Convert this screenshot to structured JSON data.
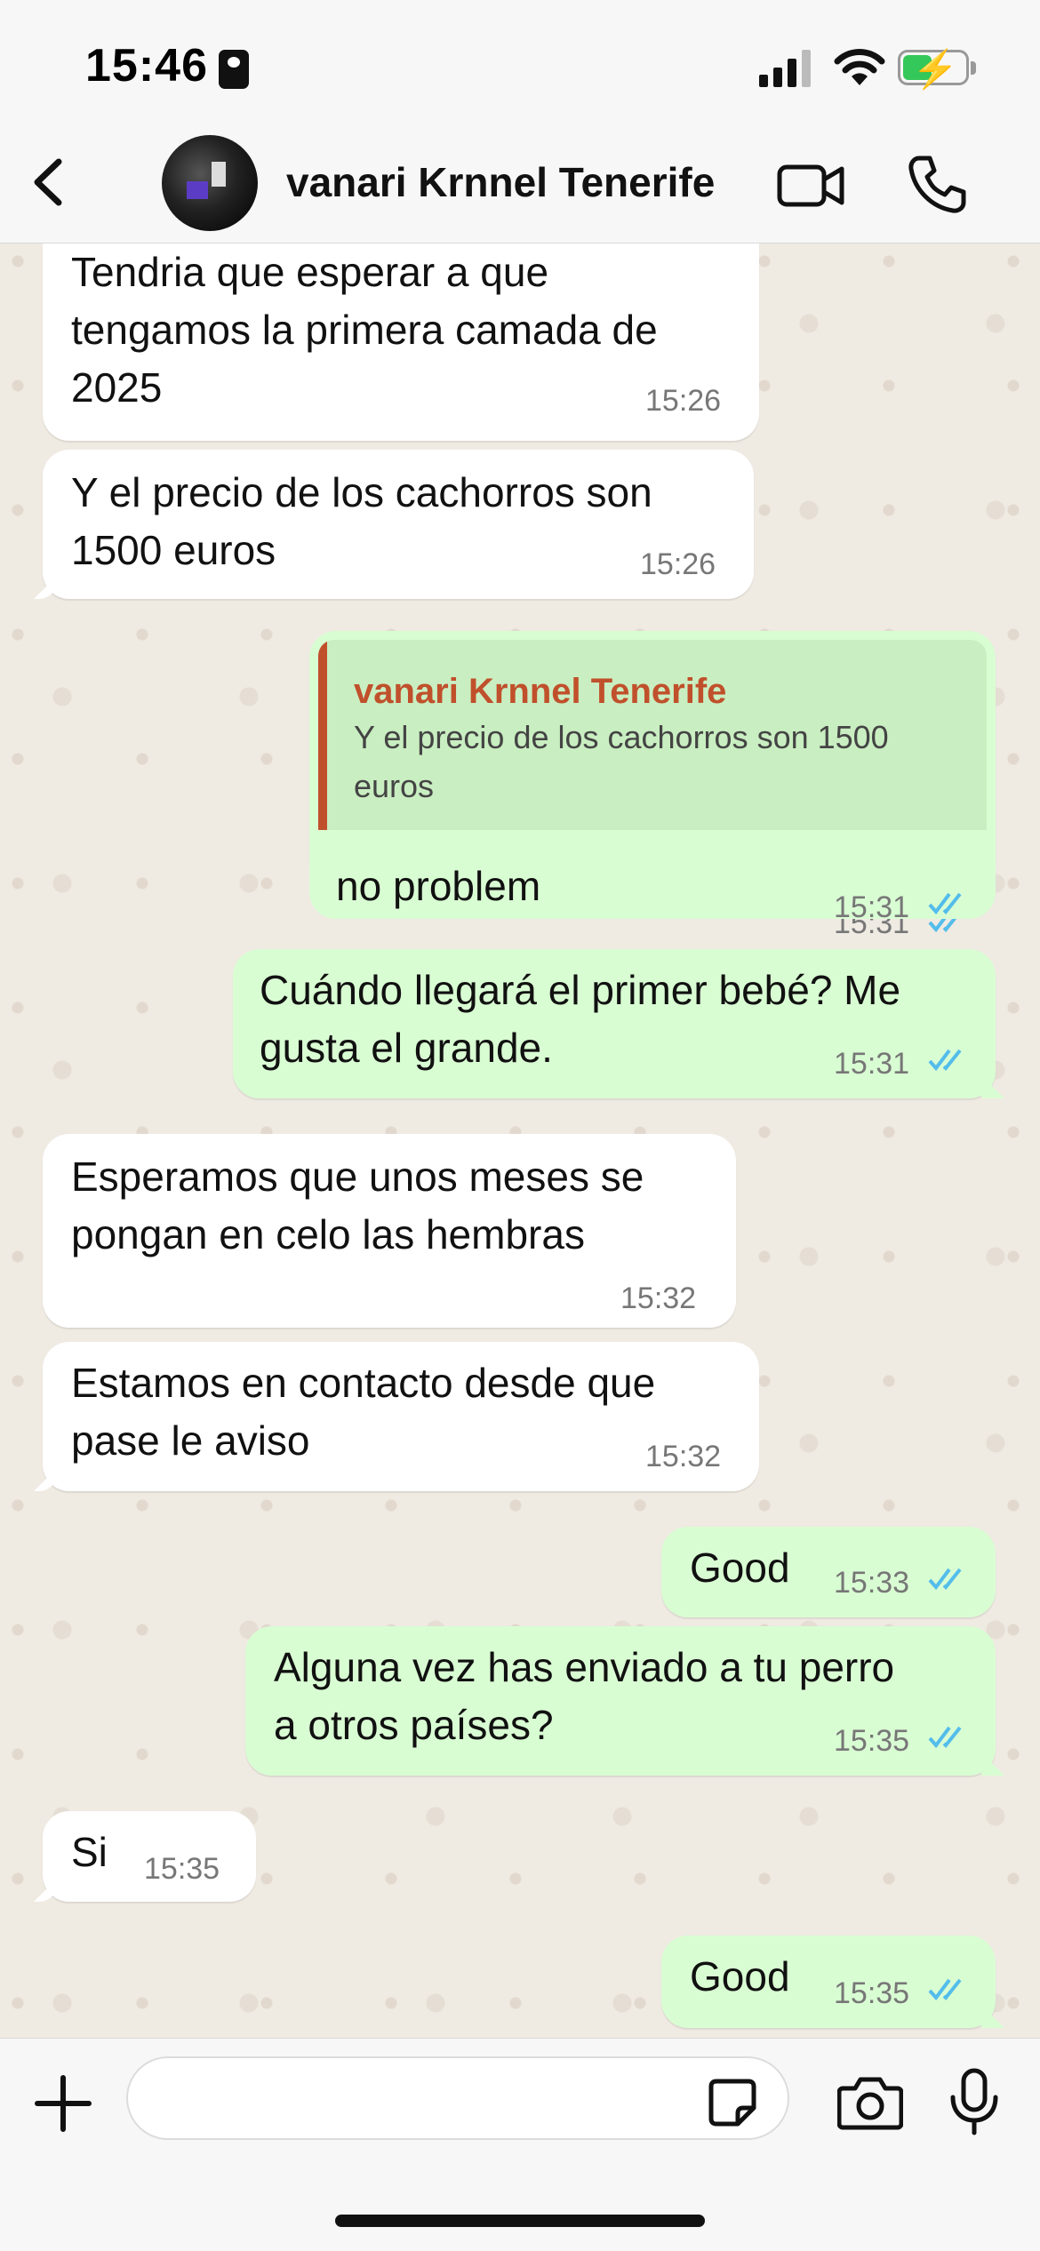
{
  "status_bar": {
    "time": "15:46"
  },
  "header": {
    "contact_name": "vanari Krnnel Tenerife"
  },
  "messages": [
    {
      "dir": "in",
      "lines": [
        "Tendria que esperar a que",
        "tengamos la primera camada de",
        "2025"
      ],
      "time": "15:26"
    },
    {
      "dir": "in",
      "lines": [
        "Y el precio de los cachorros son",
        "1500 euros"
      ],
      "time": "15:26"
    },
    {
      "dir": "out",
      "quote_name": "vanari Krnnel Tenerife",
      "quote_text": "Y el precio de los cachorros son 1500 euros",
      "lines": [
        "no problem"
      ],
      "time": "15:31"
    },
    {
      "dir": "out",
      "lines": [
        "Cuándo llegará el primer bebé? Me",
        "gusta el grande."
      ],
      "time": "15:31"
    },
    {
      "dir": "in",
      "lines": [
        "Esperamos que unos meses se",
        "pongan en celo las hembras"
      ],
      "time": "15:32"
    },
    {
      "dir": "in",
      "lines": [
        "Estamos en contacto desde que",
        "pase le aviso"
      ],
      "time": "15:32"
    },
    {
      "dir": "out",
      "lines": [
        "Good"
      ],
      "time": "15:33"
    },
    {
      "dir": "out",
      "lines": [
        "Alguna vez has enviado a tu perro",
        "a otros países?"
      ],
      "time": "15:35"
    },
    {
      "dir": "in",
      "lines": [
        "Si"
      ],
      "time": "15:35"
    },
    {
      "dir": "out",
      "lines": [
        "Good"
      ],
      "time": "15:35"
    }
  ],
  "composer": {
    "placeholder": ""
  },
  "colors": {
    "incoming": "#ffffff",
    "outgoing": "#d9fdd3",
    "ticks": "#53bdeb",
    "quote_accent": "#c0502b"
  },
  "icons": [
    "back-icon",
    "video-call-icon",
    "phone-call-icon",
    "plus-icon",
    "sticker-icon",
    "camera-icon",
    "mic-icon"
  ]
}
